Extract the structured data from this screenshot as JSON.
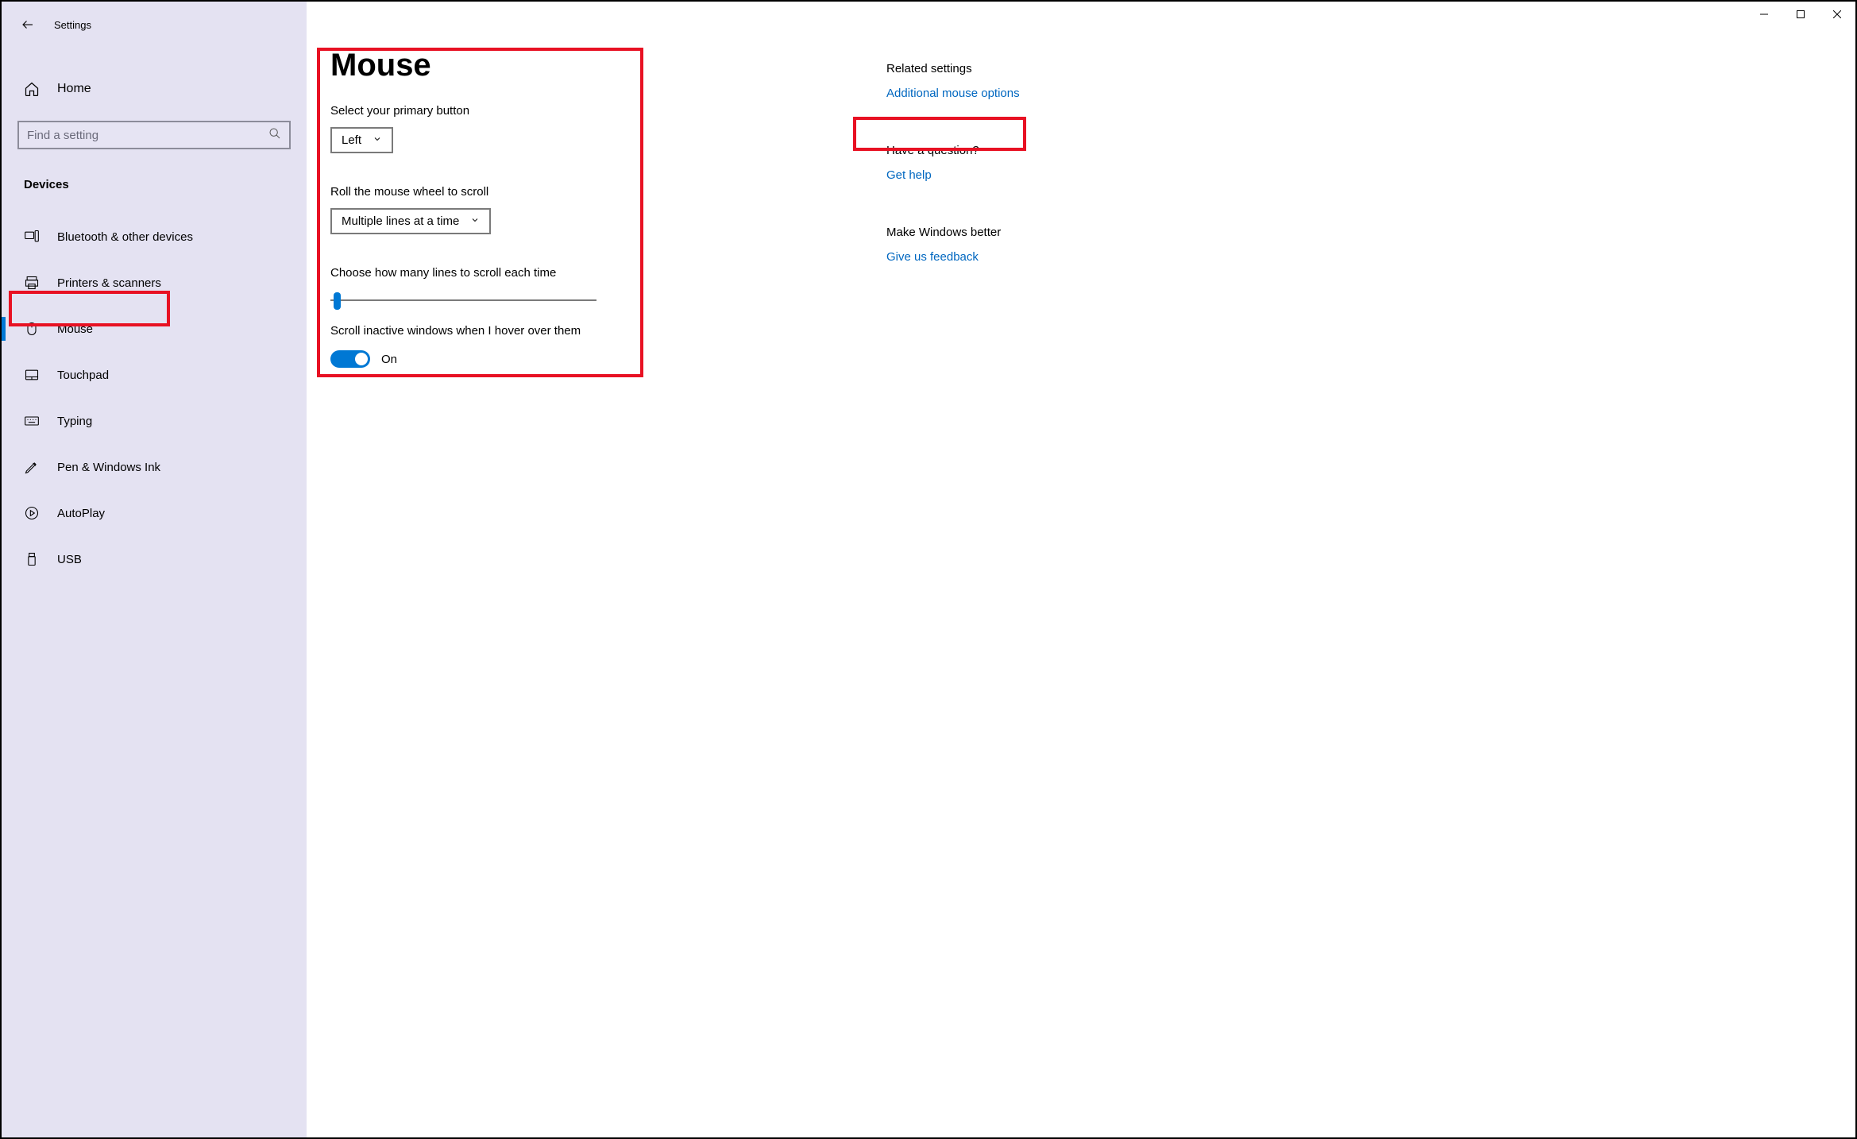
{
  "app_title": "Settings",
  "sidebar": {
    "home_label": "Home",
    "search_placeholder": "Find a setting",
    "category": "Devices",
    "items": [
      {
        "label": "Bluetooth & other devices"
      },
      {
        "label": "Printers & scanners"
      },
      {
        "label": "Mouse"
      },
      {
        "label": "Touchpad"
      },
      {
        "label": "Typing"
      },
      {
        "label": "Pen & Windows Ink"
      },
      {
        "label": "AutoPlay"
      },
      {
        "label": "USB"
      }
    ]
  },
  "main": {
    "title": "Mouse",
    "primary_button_label": "Select your primary button",
    "primary_button_value": "Left",
    "scroll_wheel_label": "Roll the mouse wheel to scroll",
    "scroll_wheel_value": "Multiple lines at a time",
    "lines_label": "Choose how many lines to scroll each time",
    "inactive_label": "Scroll inactive windows when I hover over them",
    "toggle_state": "On"
  },
  "aside": {
    "related_heading": "Related settings",
    "related_link": "Additional mouse options",
    "question_heading": "Have a question?",
    "question_link": "Get help",
    "better_heading": "Make Windows better",
    "better_link": "Give us feedback"
  }
}
